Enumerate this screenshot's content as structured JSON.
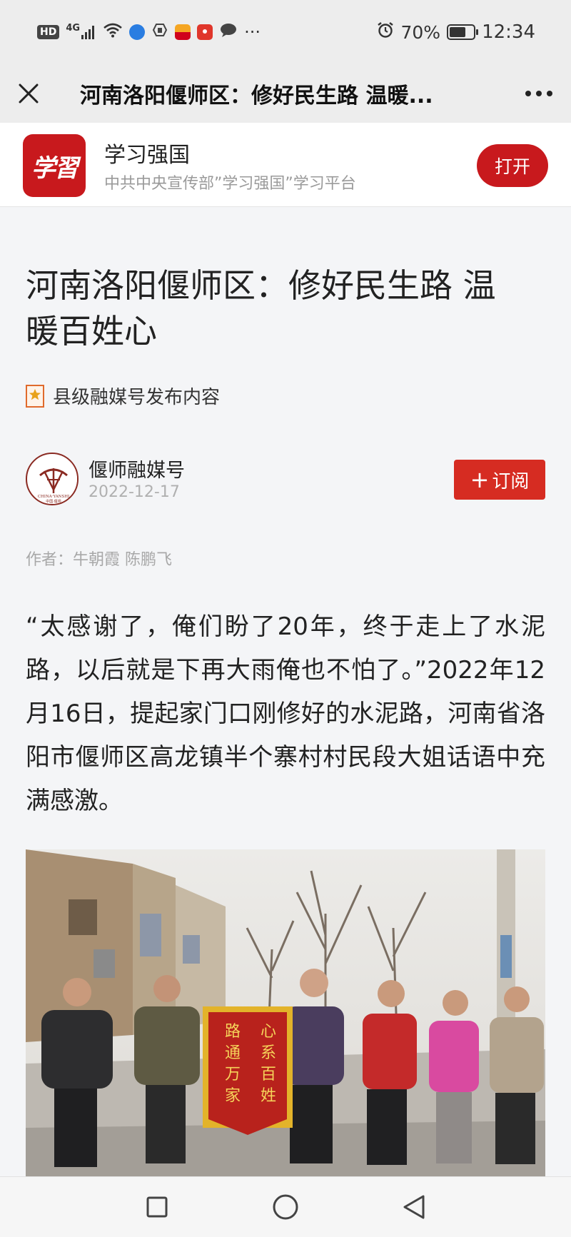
{
  "status_bar": {
    "hd_badge": "HD",
    "network_type": "4G",
    "more_dots": "···",
    "battery_percent": "70%",
    "battery_level": 0.7,
    "time": "12:34"
  },
  "nav": {
    "title": "河南洛阳偃师区：修好民生路 温暖...",
    "close_icon": "close-icon",
    "more_icon": "more-dots-icon"
  },
  "app_banner": {
    "logo_text": "学習",
    "name": "学习强国",
    "description": "中共中央宣传部”学习强国”学习平台",
    "open_label": "打开",
    "brand_color": "#c8191d"
  },
  "article": {
    "title": "河南洛阳偃师区：修好民生路 温暖百姓心",
    "tag": "县级融媒号发布内容",
    "source_name": "偃师融媒号",
    "date": "2022-12-17",
    "subscribe_label": "订阅",
    "subscribe_plus": "+",
    "byline": "作者：牛朝霞 陈鹏飞",
    "body": "“太感谢了，俺们盼了20年，终于走上了水泥路，以后就是下再大雨俺也不怕了。”2022年12月16日，提起家门口刚修好的水泥路，河南省洛阳市偃师区高龙镇半个寨村村民段大姐话语中充满感激。",
    "avatar_caption": "CHINA·YANSHI",
    "avatar_subcaption": "中国·偃师",
    "banner_right": "心系百姓",
    "banner_left": "路通万家"
  },
  "colors": {
    "accent_red": "#d62c22",
    "status_bg": "#ededed",
    "page_bg": "#f4f5f7"
  }
}
